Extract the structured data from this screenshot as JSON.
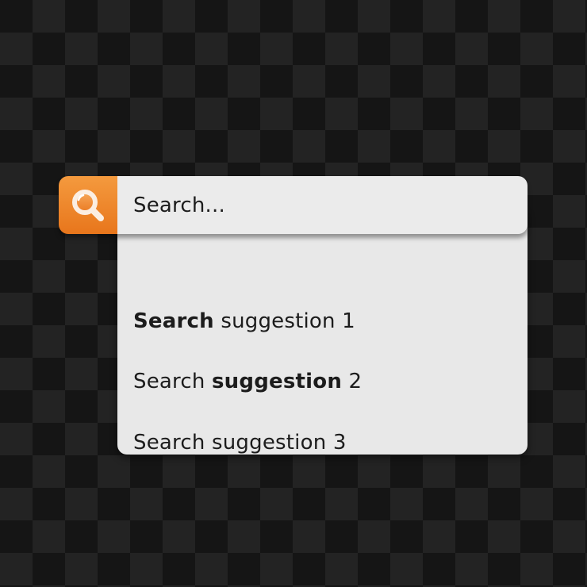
{
  "search": {
    "placeholder": "Search...",
    "icon": "search-icon",
    "accent_color": "#ee8022"
  },
  "suggestions": [
    {
      "bold": "Search",
      "rest": " suggestion 1"
    },
    {
      "prefix": "Search ",
      "bold": "suggestion",
      "suffix": " 2"
    },
    {
      "text": "Search suggestion 3"
    }
  ]
}
